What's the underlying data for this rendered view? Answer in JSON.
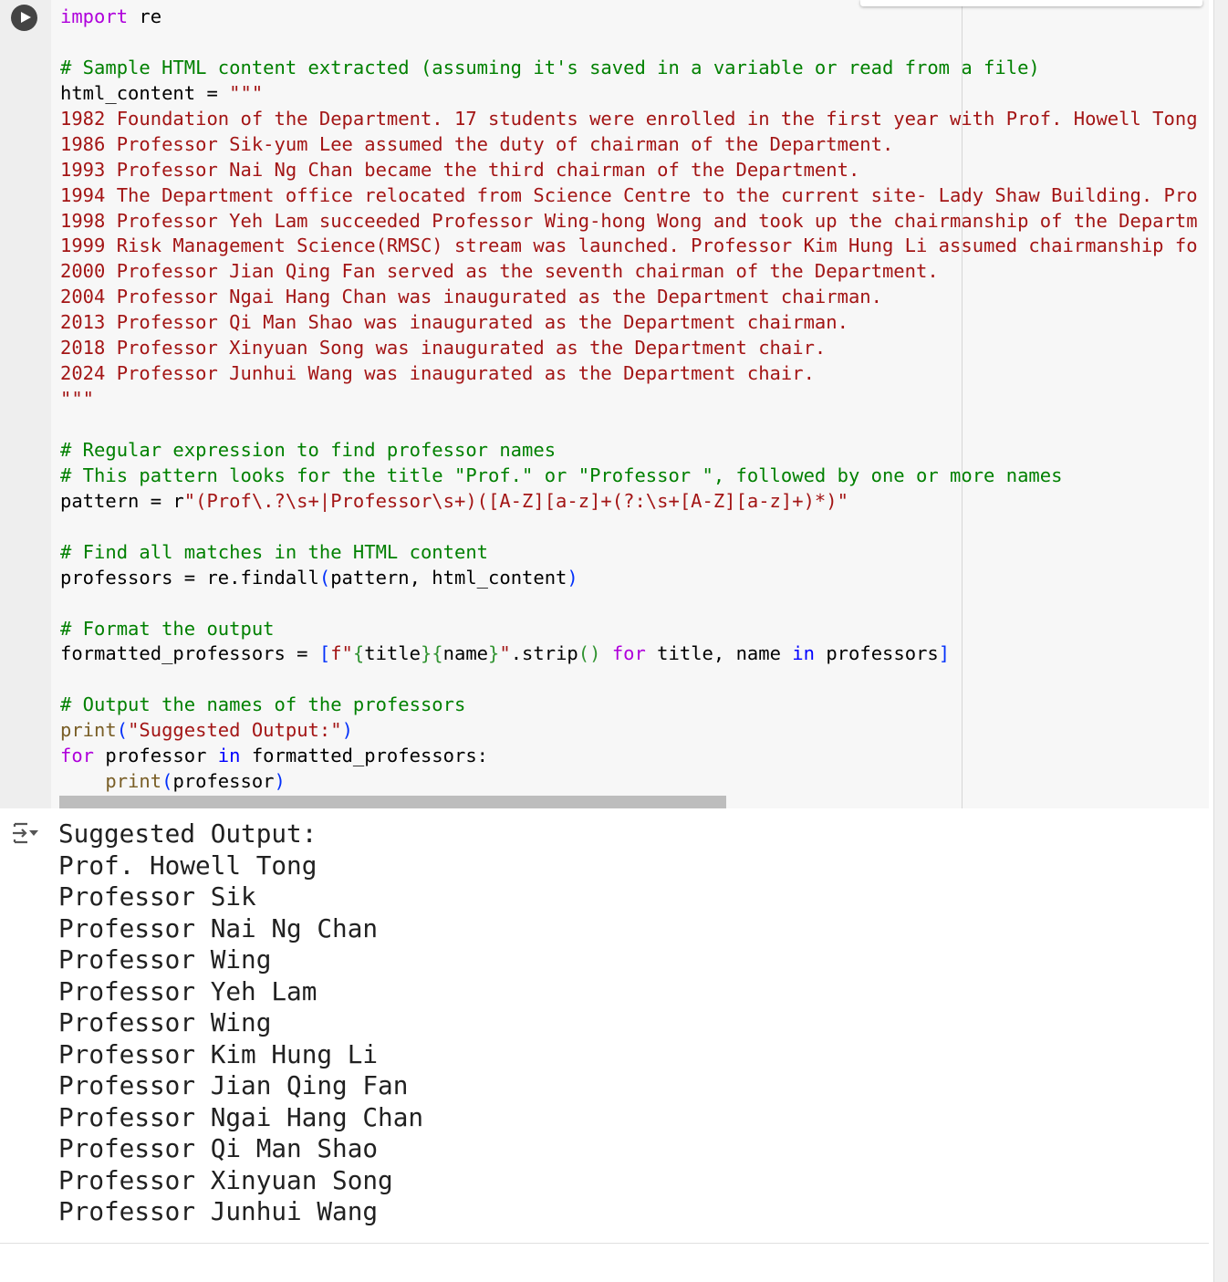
{
  "cell": {
    "run_icon": "play-circle-icon",
    "code_lines": [
      [
        {
          "t": "import",
          "c": "kw"
        },
        {
          "t": " re"
        }
      ],
      [],
      [
        {
          "t": "# Sample HTML content extracted (assuming it's saved in a variable or read from a file)",
          "c": "cm"
        }
      ],
      [
        {
          "t": "html_content = "
        },
        {
          "t": "\"\"\"",
          "c": "st"
        }
      ],
      [
        {
          "t": "1982 Foundation of the Department. 17 students were enrolled in the first year with Prof. Howell Tong",
          "c": "st"
        }
      ],
      [
        {
          "t": "1986 Professor Sik-yum Lee assumed the duty of chairman of the Department.",
          "c": "st"
        }
      ],
      [
        {
          "t": "1993 Professor Nai Ng Chan became the third chairman of the Department.",
          "c": "st"
        }
      ],
      [
        {
          "t": "1994 The Department office relocated from Science Centre to the current site- Lady Shaw Building. Pro",
          "c": "st"
        }
      ],
      [
        {
          "t": "1998 Professor Yeh Lam succeeded Professor Wing-hong Wong and took up the chairmanship of the Departm",
          "c": "st"
        }
      ],
      [
        {
          "t": "1999 Risk Management Science(RMSC) stream was launched. Professor Kim Hung Li assumed chairmanship fo",
          "c": "st"
        }
      ],
      [
        {
          "t": "2000 Professor Jian Qing Fan served as the seventh chairman of the Department.",
          "c": "st"
        }
      ],
      [
        {
          "t": "2004 Professor Ngai Hang Chan was inaugurated as the Department chairman.",
          "c": "st"
        }
      ],
      [
        {
          "t": "2013 Professor Qi Man Shao was inaugurated as the Department chairman.",
          "c": "st"
        }
      ],
      [
        {
          "t": "2018 Professor Xinyuan Song was inaugurated as the Department chair.",
          "c": "st"
        }
      ],
      [
        {
          "t": "2024 Professor Junhui Wang was inaugurated as the Department chair.",
          "c": "st"
        }
      ],
      [
        {
          "t": "\"\"\"",
          "c": "st"
        }
      ],
      [],
      [
        {
          "t": "# Regular expression to find professor names",
          "c": "cm"
        }
      ],
      [
        {
          "t": "# This pattern looks for the title \"Prof.\" or \"Professor \", followed by one or more names",
          "c": "cm"
        }
      ],
      [
        {
          "t": "pattern = r"
        },
        {
          "t": "\"(Prof\\.?\\s+|Professor\\s+)([A-Z][a-z]+(?:\\s+[A-Z][a-z]+)*)\"",
          "c": "st"
        }
      ],
      [],
      [
        {
          "t": "# Find all matches in the HTML content",
          "c": "cm"
        }
      ],
      [
        {
          "t": "professors = re.findall"
        },
        {
          "t": "(",
          "c": "br"
        },
        {
          "t": "pattern, html_content"
        },
        {
          "t": ")",
          "c": "br"
        }
      ],
      [],
      [
        {
          "t": "# Format the output",
          "c": "cm"
        }
      ],
      [
        {
          "t": "formatted_professors = "
        },
        {
          "t": "[",
          "c": "br"
        },
        {
          "t": "f\"",
          "c": "st"
        },
        {
          "t": "{",
          "c": "bg"
        },
        {
          "t": "title"
        },
        {
          "t": "}{",
          "c": "bg"
        },
        {
          "t": "name"
        },
        {
          "t": "}",
          "c": "bg"
        },
        {
          "t": "\"",
          "c": "st"
        },
        {
          "t": ".strip"
        },
        {
          "t": "()",
          "c": "bg"
        },
        {
          "t": " "
        },
        {
          "t": "for",
          "c": "kw"
        },
        {
          "t": " title, name "
        },
        {
          "t": "in",
          "c": "in"
        },
        {
          "t": " professors"
        },
        {
          "t": "]",
          "c": "br"
        }
      ],
      [],
      [
        {
          "t": "# Output the names of the professors",
          "c": "cm"
        }
      ],
      [
        {
          "t": "print",
          "c": "fn"
        },
        {
          "t": "(",
          "c": "br"
        },
        {
          "t": "\"Suggested Output:\"",
          "c": "st"
        },
        {
          "t": ")",
          "c": "br"
        }
      ],
      [
        {
          "t": "for",
          "c": "kw"
        },
        {
          "t": " professor "
        },
        {
          "t": "in",
          "c": "in"
        },
        {
          "t": " formatted_professors:"
        }
      ],
      [
        {
          "t": "    "
        },
        {
          "t": "print",
          "c": "fn"
        },
        {
          "t": "(",
          "c": "br"
        },
        {
          "t": "professor"
        },
        {
          "t": ")",
          "c": "br"
        }
      ]
    ]
  },
  "output": {
    "icon": "output-toggle-icon",
    "lines": [
      "Suggested Output:",
      "Prof. Howell Tong",
      "Professor Sik",
      "Professor Nai Ng Chan",
      "Professor Wing",
      "Professor Yeh Lam",
      "Professor Wing",
      "Professor Kim Hung Li",
      "Professor Jian Qing Fan",
      "Professor Ngai Hang Chan",
      "Professor Qi Man Shao",
      "Professor Xinyuan Song",
      "Professor Junhui Wang"
    ]
  }
}
